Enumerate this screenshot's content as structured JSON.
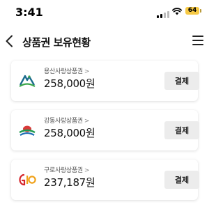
{
  "status_bar": {
    "time": "3:41",
    "battery": "64"
  },
  "header": {
    "title": "상품권 보유현황"
  },
  "vouchers": [
    {
      "name": "용산사랑상품권",
      "chevron": ">",
      "amount": "258,000원",
      "pay_label": "결제",
      "logo_icon": "yongsan-logo-icon"
    },
    {
      "name": "강동사랑상품권",
      "chevron": ">",
      "amount": "258,000원",
      "pay_label": "결제",
      "logo_icon": "gangdong-logo-icon"
    },
    {
      "name": "구로사랑상품권",
      "chevron": ">",
      "amount": "237,187원",
      "pay_label": "결제",
      "logo_icon": "guro-logo-icon"
    }
  ],
  "colors": {
    "battery": "#f6c945",
    "button_bg": "#ececec",
    "text": "#111111"
  }
}
